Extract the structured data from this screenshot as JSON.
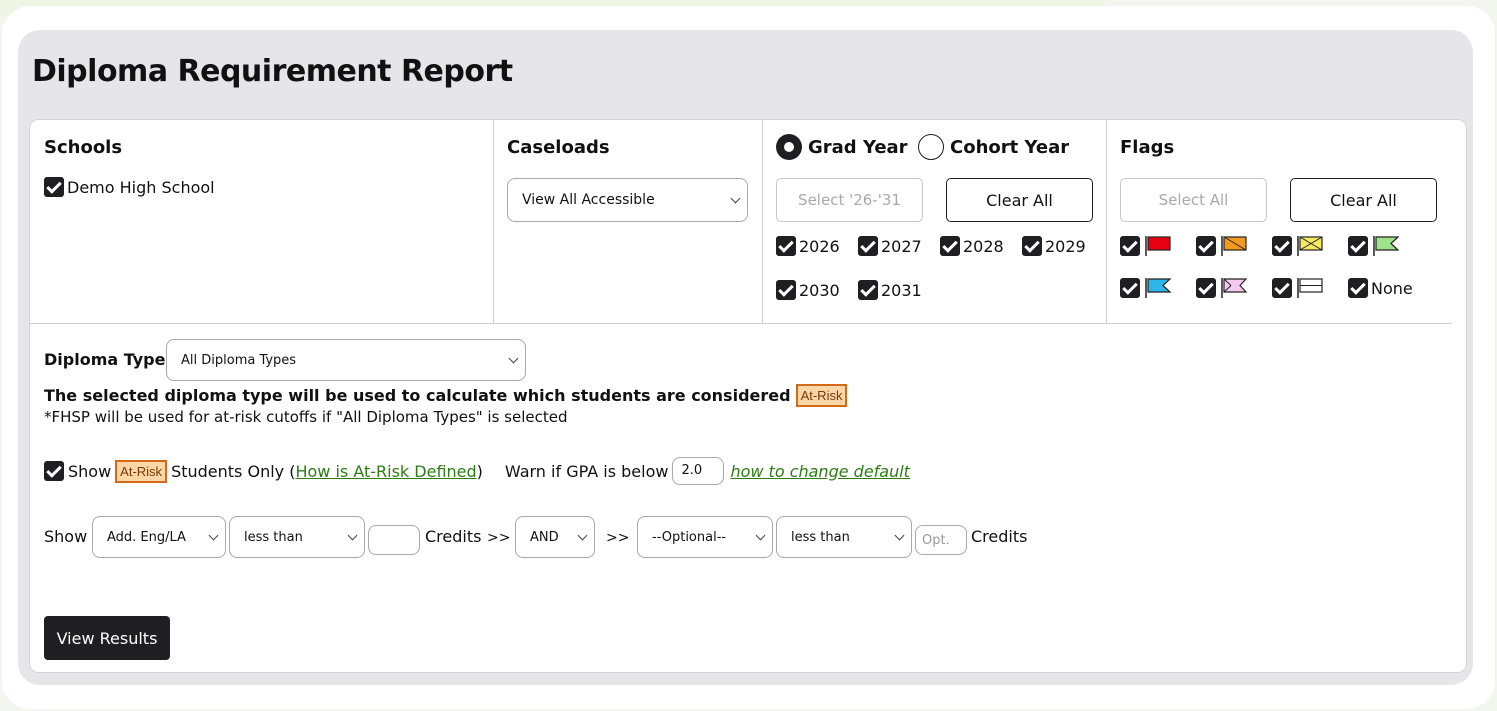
{
  "page": {
    "title": "Diploma Requirement Report"
  },
  "schools": {
    "heading": "Schools",
    "items": [
      {
        "label": "Demo High School",
        "checked": true
      }
    ]
  },
  "caseloads": {
    "heading": "Caseloads",
    "selected": "View All Accessible"
  },
  "grad": {
    "grad_year_label": "Grad Year",
    "cohort_year_label": "Cohort Year",
    "selected_mode": "Grad Year",
    "select_button": "Select '26-'31",
    "clear_button": "Clear All",
    "years": [
      "2026",
      "2027",
      "2028",
      "2029",
      "2030",
      "2031"
    ]
  },
  "flags": {
    "heading": "Flags",
    "select_button": "Select All",
    "clear_button": "Clear All",
    "items": [
      {
        "name": "red-flag",
        "color": "#e60012"
      },
      {
        "name": "orange-flag",
        "color": "#f39a1e"
      },
      {
        "name": "yellow-flag",
        "color": "#f4ea62"
      },
      {
        "name": "green-flag",
        "color": "#9ee38a"
      },
      {
        "name": "blue-flag",
        "color": "#2fb5ea"
      },
      {
        "name": "pink-flag",
        "color": "#f6c9ee"
      },
      {
        "name": "white-flag",
        "color": "#ffffff"
      }
    ],
    "none_label": "None"
  },
  "diploma": {
    "label": "Diploma Type:",
    "selected": "All Diploma Types",
    "note_prefix": "The selected diploma type will be used to calculate which students are considered",
    "at_risk_tag": "At-Risk",
    "footnote": "*FHSP will be used for at-risk cutoffs if \"All Diploma Types\" is selected"
  },
  "show_at_risk": {
    "show_label": "Show",
    "tag": "At-Risk",
    "students_only": "Students Only (",
    "link": "How is At-Risk Defined",
    "close_paren": ")",
    "warn_label": "Warn if GPA is below",
    "gpa_value": "2.0",
    "change_link": "how to change default"
  },
  "filter": {
    "show_label": "Show",
    "subject": "Add. Eng/LA",
    "comparator1": "less than",
    "credits_label1": "Credits",
    "arrow1": ">>",
    "logic": "AND",
    "arrow2": ">>",
    "optional": "--Optional--",
    "comparator2": "less than",
    "opt_placeholder": "Opt.",
    "credits_label2": "Credits"
  },
  "actions": {
    "view_results": "View Results"
  },
  "colors": {
    "accent_dark": "#1f1f23",
    "at_risk_bg": "#fbd7a7",
    "at_risk_border": "#d16b1a",
    "link_green": "#2e7d14"
  }
}
